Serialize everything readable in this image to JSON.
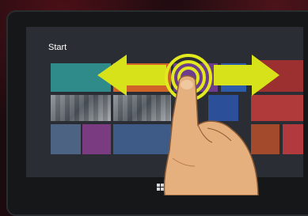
{
  "screen": {
    "title": "Start"
  },
  "colors": {
    "background": "#1a0b0f",
    "screen": "#2a2e34",
    "arrow": "#d7e21a",
    "ring": "#e2ea1f",
    "skin": "#e6b07e"
  },
  "icons": [
    "windows-logo-icon",
    "left-arrow-icon",
    "right-arrow-icon",
    "touch-ring-icon",
    "finger-hand-icon"
  ],
  "gesture": {
    "type": "swipe-horizontal"
  }
}
